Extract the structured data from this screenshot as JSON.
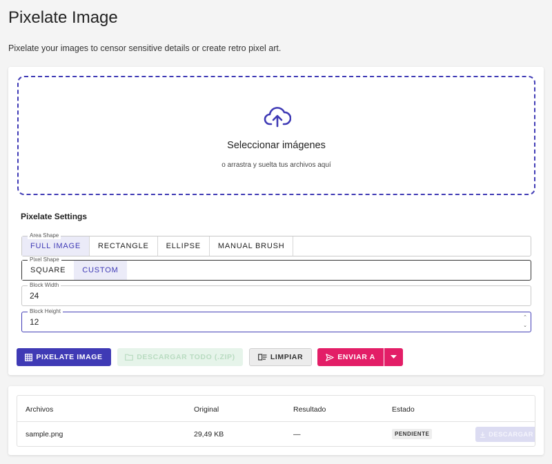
{
  "page": {
    "title": "Pixelate Image",
    "subtitle": "Pixelate your images to censor sensitive details or create retro pixel art."
  },
  "dropzone": {
    "icon": "cloud-upload-icon",
    "title": "Seleccionar imágenes",
    "subtitle": "o arrastra y suelta tus archivos aquí"
  },
  "settings": {
    "title": "Pixelate Settings",
    "area_shape": {
      "label": "Area Shape",
      "options": [
        "FULL IMAGE",
        "RECTANGLE",
        "ELLIPSE",
        "MANUAL BRUSH"
      ],
      "selected": "FULL IMAGE"
    },
    "pixel_shape": {
      "label": "Pixel Shape",
      "options": [
        "SQUARE",
        "CUSTOM"
      ],
      "selected": "CUSTOM"
    },
    "block_width": {
      "label": "Block Width",
      "value": "24"
    },
    "block_height": {
      "label": "Block Height",
      "value": "12"
    }
  },
  "actions": {
    "pixelate": "PIXELATE IMAGE",
    "download_all": "DESCARGAR TODO (.ZIP)",
    "clear": "LIMPIAR",
    "send_to": "ENVIAR A"
  },
  "table": {
    "headers": [
      "Archivos",
      "Original",
      "Resultado",
      "Estado"
    ],
    "rows": [
      {
        "file": "sample.png",
        "original": "29,49 KB",
        "result": "—",
        "status": "PENDIENTE",
        "download": "DESCARGAR"
      }
    ]
  },
  "colors": {
    "accent": "#3f3ab5",
    "send": "#e31e67",
    "disabled_green": "#e6f4ea"
  }
}
